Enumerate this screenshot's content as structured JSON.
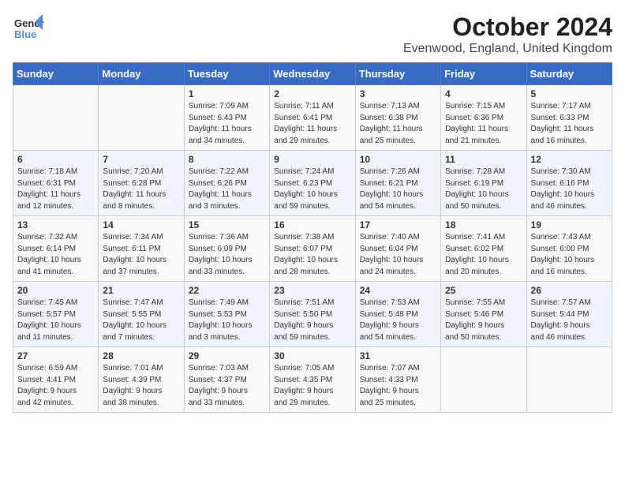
{
  "header": {
    "logo_line1": "General",
    "logo_line2": "Blue",
    "title": "October 2024",
    "subtitle": "Evenwood, England, United Kingdom"
  },
  "days_of_week": [
    "Sunday",
    "Monday",
    "Tuesday",
    "Wednesday",
    "Thursday",
    "Friday",
    "Saturday"
  ],
  "weeks": [
    [
      {
        "day": "",
        "content": ""
      },
      {
        "day": "",
        "content": ""
      },
      {
        "day": "1",
        "content": "Sunrise: 7:09 AM\nSunset: 6:43 PM\nDaylight: 11 hours\nand 34 minutes."
      },
      {
        "day": "2",
        "content": "Sunrise: 7:11 AM\nSunset: 6:41 PM\nDaylight: 11 hours\nand 29 minutes."
      },
      {
        "day": "3",
        "content": "Sunrise: 7:13 AM\nSunset: 6:38 PM\nDaylight: 11 hours\nand 25 minutes."
      },
      {
        "day": "4",
        "content": "Sunrise: 7:15 AM\nSunset: 6:36 PM\nDaylight: 11 hours\nand 21 minutes."
      },
      {
        "day": "5",
        "content": "Sunrise: 7:17 AM\nSunset: 6:33 PM\nDaylight: 11 hours\nand 16 minutes."
      }
    ],
    [
      {
        "day": "6",
        "content": "Sunrise: 7:18 AM\nSunset: 6:31 PM\nDaylight: 11 hours\nand 12 minutes."
      },
      {
        "day": "7",
        "content": "Sunrise: 7:20 AM\nSunset: 6:28 PM\nDaylight: 11 hours\nand 8 minutes."
      },
      {
        "day": "8",
        "content": "Sunrise: 7:22 AM\nSunset: 6:26 PM\nDaylight: 11 hours\nand 3 minutes."
      },
      {
        "day": "9",
        "content": "Sunrise: 7:24 AM\nSunset: 6:23 PM\nDaylight: 10 hours\nand 59 minutes."
      },
      {
        "day": "10",
        "content": "Sunrise: 7:26 AM\nSunset: 6:21 PM\nDaylight: 10 hours\nand 54 minutes."
      },
      {
        "day": "11",
        "content": "Sunrise: 7:28 AM\nSunset: 6:19 PM\nDaylight: 10 hours\nand 50 minutes."
      },
      {
        "day": "12",
        "content": "Sunrise: 7:30 AM\nSunset: 6:16 PM\nDaylight: 10 hours\nand 46 minutes."
      }
    ],
    [
      {
        "day": "13",
        "content": "Sunrise: 7:32 AM\nSunset: 6:14 PM\nDaylight: 10 hours\nand 41 minutes."
      },
      {
        "day": "14",
        "content": "Sunrise: 7:34 AM\nSunset: 6:11 PM\nDaylight: 10 hours\nand 37 minutes."
      },
      {
        "day": "15",
        "content": "Sunrise: 7:36 AM\nSunset: 6:09 PM\nDaylight: 10 hours\nand 33 minutes."
      },
      {
        "day": "16",
        "content": "Sunrise: 7:38 AM\nSunset: 6:07 PM\nDaylight: 10 hours\nand 28 minutes."
      },
      {
        "day": "17",
        "content": "Sunrise: 7:40 AM\nSunset: 6:04 PM\nDaylight: 10 hours\nand 24 minutes."
      },
      {
        "day": "18",
        "content": "Sunrise: 7:41 AM\nSunset: 6:02 PM\nDaylight: 10 hours\nand 20 minutes."
      },
      {
        "day": "19",
        "content": "Sunrise: 7:43 AM\nSunset: 6:00 PM\nDaylight: 10 hours\nand 16 minutes."
      }
    ],
    [
      {
        "day": "20",
        "content": "Sunrise: 7:45 AM\nSunset: 5:57 PM\nDaylight: 10 hours\nand 11 minutes."
      },
      {
        "day": "21",
        "content": "Sunrise: 7:47 AM\nSunset: 5:55 PM\nDaylight: 10 hours\nand 7 minutes."
      },
      {
        "day": "22",
        "content": "Sunrise: 7:49 AM\nSunset: 5:53 PM\nDaylight: 10 hours\nand 3 minutes."
      },
      {
        "day": "23",
        "content": "Sunrise: 7:51 AM\nSunset: 5:50 PM\nDaylight: 9 hours\nand 59 minutes."
      },
      {
        "day": "24",
        "content": "Sunrise: 7:53 AM\nSunset: 5:48 PM\nDaylight: 9 hours\nand 54 minutes."
      },
      {
        "day": "25",
        "content": "Sunrise: 7:55 AM\nSunset: 5:46 PM\nDaylight: 9 hours\nand 50 minutes."
      },
      {
        "day": "26",
        "content": "Sunrise: 7:57 AM\nSunset: 5:44 PM\nDaylight: 9 hours\nand 46 minutes."
      }
    ],
    [
      {
        "day": "27",
        "content": "Sunrise: 6:59 AM\nSunset: 4:41 PM\nDaylight: 9 hours\nand 42 minutes."
      },
      {
        "day": "28",
        "content": "Sunrise: 7:01 AM\nSunset: 4:39 PM\nDaylight: 9 hours\nand 38 minutes."
      },
      {
        "day": "29",
        "content": "Sunrise: 7:03 AM\nSunset: 4:37 PM\nDaylight: 9 hours\nand 33 minutes."
      },
      {
        "day": "30",
        "content": "Sunrise: 7:05 AM\nSunset: 4:35 PM\nDaylight: 9 hours\nand 29 minutes."
      },
      {
        "day": "31",
        "content": "Sunrise: 7:07 AM\nSunset: 4:33 PM\nDaylight: 9 hours\nand 25 minutes."
      },
      {
        "day": "",
        "content": ""
      },
      {
        "day": "",
        "content": ""
      }
    ]
  ]
}
